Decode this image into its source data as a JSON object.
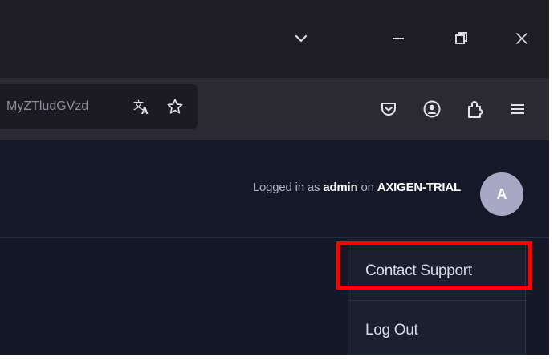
{
  "browser": {
    "url_fragment": "MyZTludGVzd",
    "icons": {
      "tabs_dropdown": "chevron-down-icon",
      "minimize": "minimize-icon",
      "restore": "restore-icon",
      "close": "close-icon",
      "translate": "translate-icon",
      "bookmark": "star-icon",
      "pocket": "pocket-icon",
      "account": "account-icon",
      "extensions": "extensions-icon",
      "menu": "hamburger-icon"
    }
  },
  "header": {
    "login_prefix": "Logged in as ",
    "username": "admin",
    "login_middle": " on ",
    "server": "AXIGEN-TRIAL",
    "avatar_letter": "A"
  },
  "user_menu": {
    "items": [
      {
        "label": "Contact Support"
      },
      {
        "label": "Log Out"
      }
    ]
  },
  "colors": {
    "app_background": "#141827",
    "menu_background": "#1b2030",
    "avatar": "#a8a8c4",
    "highlight": "#ff0000"
  }
}
